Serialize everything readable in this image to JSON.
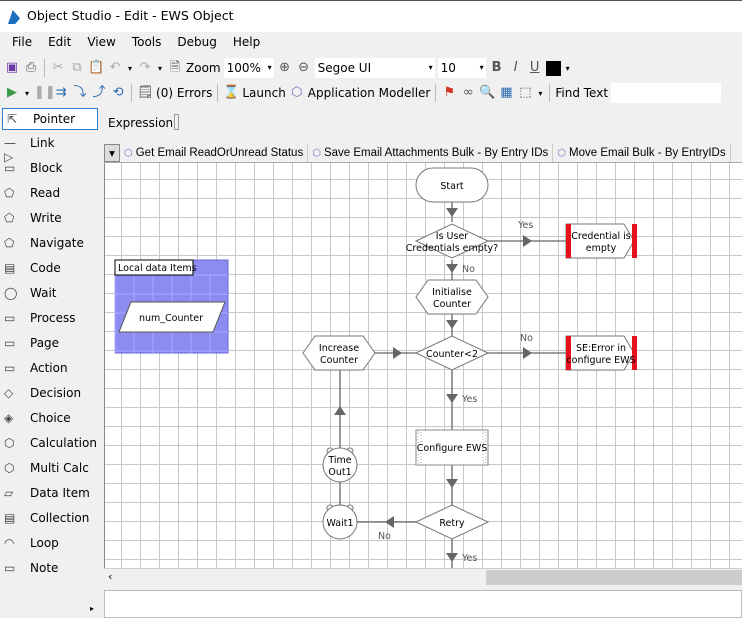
{
  "window": {
    "title": "Object Studio  - Edit - EWS Object"
  },
  "menu": [
    "File",
    "Edit",
    "View",
    "Tools",
    "Debug",
    "Help"
  ],
  "toolbar1": {
    "zoom_label": "Zoom",
    "zoom_value": "100%",
    "font": "Segoe UI",
    "font_size": "10",
    "bold": "B",
    "italic": "I",
    "underline": "U",
    "color": "#000000"
  },
  "toolbar2": {
    "errors": "(0) Errors",
    "launch": "Launch",
    "app_modeller": "Application Modeller",
    "find_text": "Find Text"
  },
  "palette": [
    "Pointer",
    "Link",
    "Block",
    "Read",
    "Write",
    "Navigate",
    "Code",
    "Wait",
    "Process",
    "Page",
    "Action",
    "Decision",
    "Choice",
    "Calculation",
    "Multi Calc",
    "Data Item",
    "Collection",
    "Loop",
    "Note"
  ],
  "expression": {
    "label": "Expression:",
    "value": ""
  },
  "tabs": [
    "Get Email ReadOrUnread Status",
    "Save Email Attachments Bulk - By Entry IDs",
    "Move Email Bulk - By EntryIDs"
  ],
  "diagram": {
    "block_title": "Local data Items",
    "data_item": "num_Counter",
    "nodes": {
      "start": "Start",
      "check_creds": "Is User Credentials empty?",
      "cred_empty": "Credential is empty",
      "init": "Initialise Counter",
      "counter": "Counter<2",
      "se_error": "SE:Error in configure EWS",
      "increase": "Increase Counter",
      "configure": "Configure EWS",
      "retry": "Retry",
      "wait1": "Wait1",
      "timeout1": "Time Out1"
    },
    "labels": {
      "yes1": "Yes",
      "no1": "No",
      "no2": "No",
      "yes2": "Yes",
      "no3": "No",
      "yes3": "Yes"
    },
    "colors": {
      "end_bar": "#e8101c",
      "block_fill": "#8c8cf0",
      "line": "#666666"
    }
  }
}
